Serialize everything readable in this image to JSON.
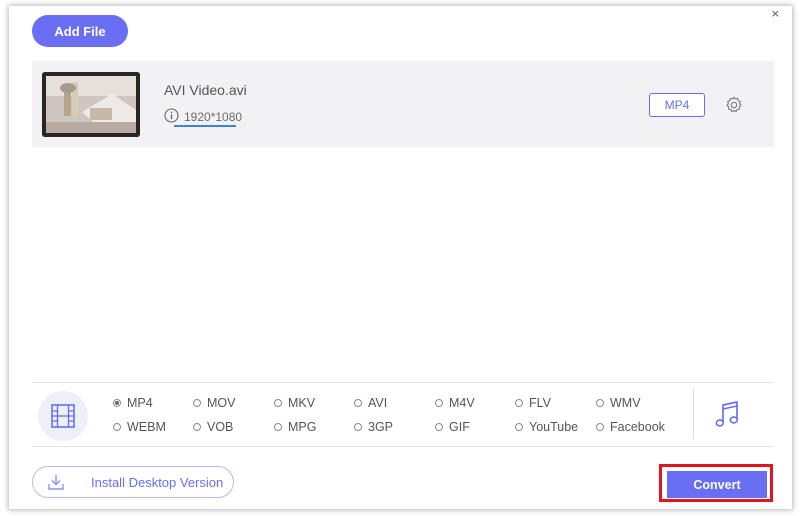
{
  "window": {
    "close_glyph": "×"
  },
  "toolbar": {
    "add_file_label": "Add File"
  },
  "file": {
    "name": "AVI Video.avi",
    "resolution": "1920*1080",
    "output_format": "MP4",
    "info_icon": "info-icon",
    "settings_icon": "gear-icon"
  },
  "formats": {
    "row1": [
      "MP4",
      "MOV",
      "MKV",
      "AVI",
      "M4V",
      "FLV",
      "WMV"
    ],
    "row2": [
      "WEBM",
      "VOB",
      "MPG",
      "3GP",
      "GIF",
      "YouTube",
      "Facebook"
    ],
    "selected": "MP4",
    "video_tab_icon": "film-icon",
    "audio_tab_icon": "music-note-icon"
  },
  "footer": {
    "install_label": "Install Desktop Version",
    "convert_label": "Convert"
  },
  "colors": {
    "accent": "#6a6ef2",
    "highlight_outline": "#e0161d",
    "file_row_bg": "#f2f2f4"
  }
}
